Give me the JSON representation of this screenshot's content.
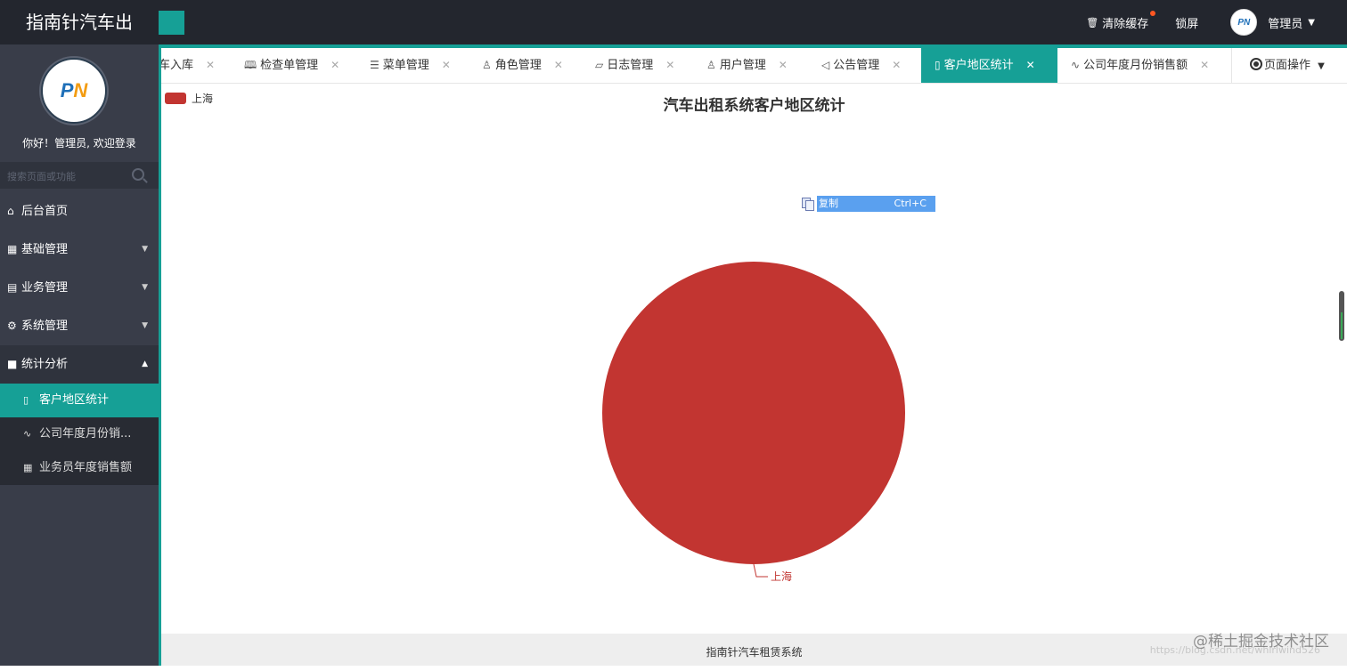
{
  "header": {
    "brand": "指南针汽车出",
    "clear_cache": "清除缓存",
    "lock_screen": "锁屏",
    "user": "管理员"
  },
  "sidebar": {
    "welcome": "你好！管理员, 欢迎登录",
    "search_placeholder": "搜索页面或功能",
    "items": [
      {
        "label": "后台首页",
        "icon": "home-icon"
      },
      {
        "label": "基础管理",
        "icon": "grid-icon"
      },
      {
        "label": "业务管理",
        "icon": "book-icon"
      },
      {
        "label": "系统管理",
        "icon": "gear-icon"
      },
      {
        "label": "统计分析",
        "icon": "monitor-icon"
      }
    ],
    "sub_items": [
      {
        "label": "客户地区统计",
        "icon": "document-icon"
      },
      {
        "label": "公司年度月份销...",
        "icon": "pulse-icon"
      },
      {
        "label": "业务员年度销售额",
        "icon": "table-icon"
      }
    ]
  },
  "tabs": [
    {
      "label": "车入库",
      "icon": ""
    },
    {
      "label": "检查单管理",
      "icon": "book-icon"
    },
    {
      "label": "菜单管理",
      "icon": "menu-icon"
    },
    {
      "label": "角色管理",
      "icon": "user-icon"
    },
    {
      "label": "日志管理",
      "icon": "note-icon"
    },
    {
      "label": "用户管理",
      "icon": "users-icon"
    },
    {
      "label": "公告管理",
      "icon": "speaker-icon"
    },
    {
      "label": "客户地区统计",
      "icon": "document-icon"
    },
    {
      "label": "公司年度月份销售额",
      "icon": "pulse-icon"
    }
  ],
  "page_ops": "页面操作",
  "context_menu": {
    "label": "复制",
    "shortcut": "Ctrl+C"
  },
  "chart_data": {
    "type": "pie",
    "title": "汽车出租系统客户地区统计",
    "legend": [
      "上海"
    ],
    "legend_position": "top-left",
    "slices": [
      {
        "name": "上海",
        "value": 1,
        "color": "#c23531"
      }
    ]
  },
  "footer": "指南针汽车租赁系统",
  "watermark": "@稀土掘金技术社区",
  "watermark_url": "https://blog.csdn.net/whirlwind526"
}
